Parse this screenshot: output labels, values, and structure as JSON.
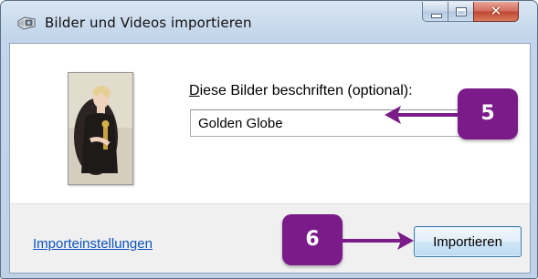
{
  "window": {
    "title": "Bilder und Videos importieren",
    "controls": {
      "minimize": "minimize",
      "maximize": "maximize",
      "close": "✕"
    }
  },
  "main": {
    "caption_label": "Diese Bilder beschriften (optional):",
    "caption_label_accesskey": "D",
    "caption_label_rest": "iese Bilder beschriften (optional):",
    "caption_value": "Golden Globe",
    "thumbnail_icon": "photo-thumbnail"
  },
  "footer": {
    "settings_link": "Importeinstellungen",
    "import_button": "Importieren"
  },
  "annotations": {
    "step_caption": "5",
    "step_import": "6",
    "color": "#7b1b8a"
  }
}
